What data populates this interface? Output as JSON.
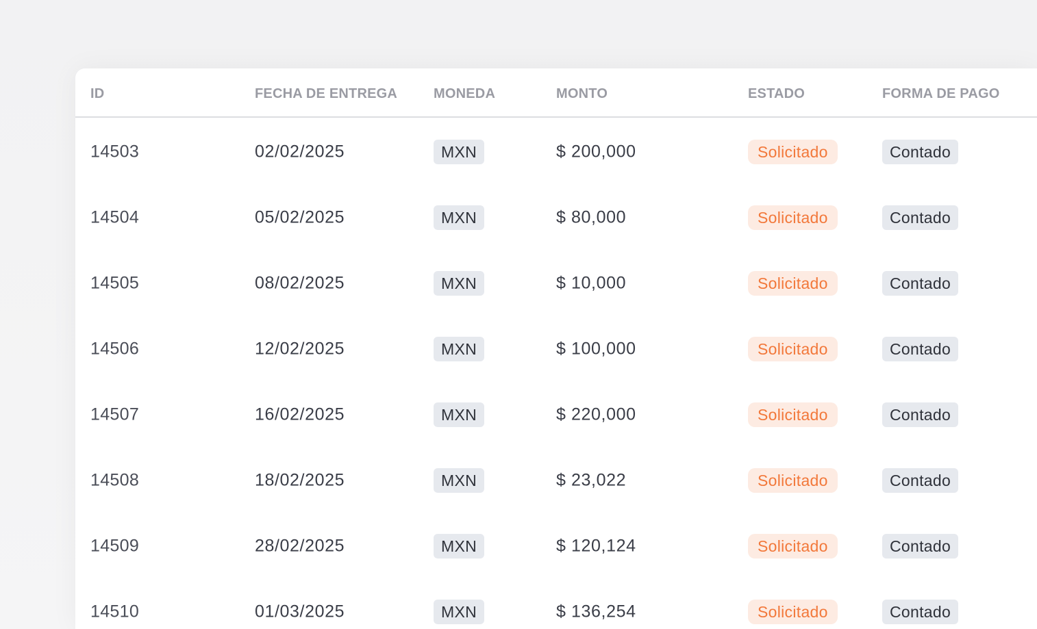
{
  "table": {
    "headers": {
      "id": "ID",
      "delivery_date": "FECHA DE ENTREGA",
      "currency": "MONEDA",
      "amount": "MONTO",
      "status": "ESTADO",
      "payment_method": "FORMA DE PAGO"
    },
    "rows": [
      {
        "id": "14503",
        "delivery_date": "02/02/2025",
        "currency": "MXN",
        "amount": "$ 200,000",
        "status": "Solicitado",
        "payment_method": "Contado"
      },
      {
        "id": "14504",
        "delivery_date": "05/02/2025",
        "currency": "MXN",
        "amount": "$ 80,000",
        "status": "Solicitado",
        "payment_method": "Contado"
      },
      {
        "id": "14505",
        "delivery_date": "08/02/2025",
        "currency": "MXN",
        "amount": "$ 10,000",
        "status": "Solicitado",
        "payment_method": "Contado"
      },
      {
        "id": "14506",
        "delivery_date": "12/02/2025",
        "currency": "MXN",
        "amount": "$ 100,000",
        "status": "Solicitado",
        "payment_method": "Contado"
      },
      {
        "id": "14507",
        "delivery_date": "16/02/2025",
        "currency": "MXN",
        "amount": "$ 220,000",
        "status": "Solicitado",
        "payment_method": "Contado"
      },
      {
        "id": "14508",
        "delivery_date": "18/02/2025",
        "currency": "MXN",
        "amount": "$ 23,022",
        "status": "Solicitado",
        "payment_method": "Contado"
      },
      {
        "id": "14509",
        "delivery_date": "28/02/2025",
        "currency": "MXN",
        "amount": "$ 120,124",
        "status": "Solicitado",
        "payment_method": "Contado"
      },
      {
        "id": "14510",
        "delivery_date": "01/03/2025",
        "currency": "MXN",
        "amount": "$ 136,254",
        "status": "Solicitado",
        "payment_method": "Contado"
      }
    ]
  },
  "colors": {
    "header_text": "#9a9ba3",
    "status_text": "#f2783a",
    "status_bg": "#fdebe2",
    "tag_bg": "#e6e9ee"
  }
}
